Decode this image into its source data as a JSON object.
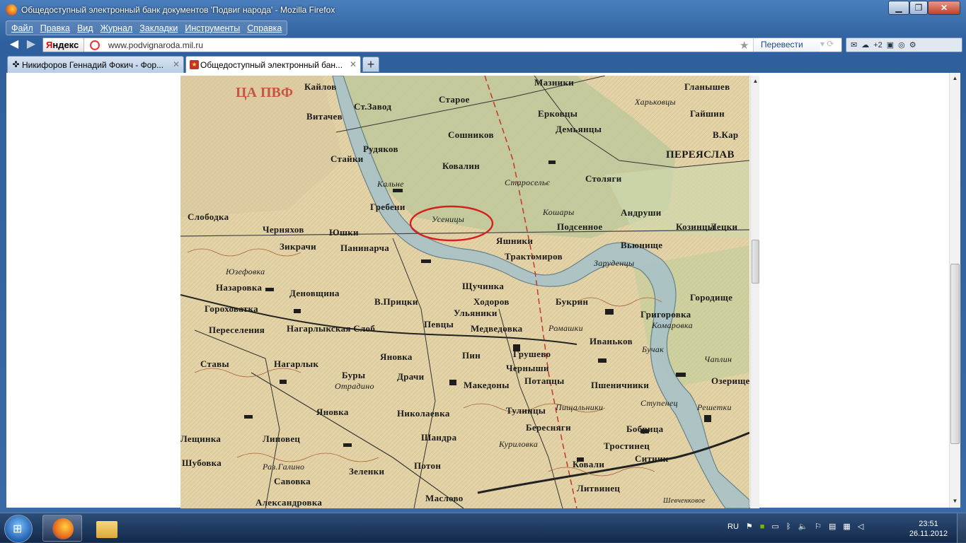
{
  "window": {
    "title": "Общедоступный электронный банк документов 'Подвиг народа' - Mozilla Firefox",
    "minimize_icon": "minimize-icon",
    "maximize_icon": "maximize-icon",
    "close_icon": "close-icon"
  },
  "menu": [
    "Файл",
    "Правка",
    "Вид",
    "Журнал",
    "Закладки",
    "Инструменты",
    "Справка"
  ],
  "navbar": {
    "search_engine": {
      "first": "Я",
      "rest": "ндекс"
    },
    "url": "www.podvignaroda.mil.ru",
    "translate_label": "Перевести",
    "addons_count": "+2"
  },
  "tabs": [
    {
      "label": "Никифоров Геннадий Фокич - Фор...",
      "active": false,
      "icon": "cross-icon"
    },
    {
      "label": "Общедоступный электронный бан...",
      "active": true,
      "icon": "star-medal-icon"
    }
  ],
  "new_tab_label": "+",
  "map": {
    "labels": [
      {
        "text": "Кайлов"
      },
      {
        "text": "Ст.Завод"
      },
      {
        "text": "Старое"
      },
      {
        "text": "Мазники"
      },
      {
        "text": "Гланышев"
      },
      {
        "text": "Харьковцы"
      },
      {
        "text": "Гайшин"
      },
      {
        "text": "Витачев"
      },
      {
        "text": "Ерковцы"
      },
      {
        "text": "Демьянцы"
      },
      {
        "text": "Сошников"
      },
      {
        "text": "В.Кар"
      },
      {
        "text": "Рудяков"
      },
      {
        "text": "Ковалин"
      },
      {
        "text": "ПЕРЕЯСЛАВ"
      },
      {
        "text": "Стайки"
      },
      {
        "text": "Столяги"
      },
      {
        "text": "Старосельє"
      },
      {
        "text": "Гребени"
      },
      {
        "text": "Андруши"
      },
      {
        "text": "Кошары"
      },
      {
        "text": "Козинцы"
      },
      {
        "text": "Лецки"
      },
      {
        "text": "Подсенное"
      },
      {
        "text": "Слободка"
      },
      {
        "text": "Черняхов"
      },
      {
        "text": "Юшки"
      },
      {
        "text": "Усеницы"
      },
      {
        "text": "Яшники"
      },
      {
        "text": "Трактомиров"
      },
      {
        "text": "Зикрачи"
      },
      {
        "text": "Панинарча"
      },
      {
        "text": "Вьюнище"
      },
      {
        "text": "Юзефовка"
      },
      {
        "text": "Назаровка"
      },
      {
        "text": "Деновщина"
      },
      {
        "text": "Щучинка"
      },
      {
        "text": "Заруденцы"
      },
      {
        "text": "Городище"
      },
      {
        "text": "В.Прицки"
      },
      {
        "text": "Ходоров"
      },
      {
        "text": "Букрин"
      },
      {
        "text": "Гороховатка"
      },
      {
        "text": "Ульяники"
      },
      {
        "text": "Григоровка"
      },
      {
        "text": "Переселения"
      },
      {
        "text": "Нагарлыкская Слоб"
      },
      {
        "text": "Певцы"
      },
      {
        "text": "Медведовка"
      },
      {
        "text": "Комаровка"
      },
      {
        "text": "Ромашки"
      },
      {
        "text": "Иваньков"
      },
      {
        "text": "Пин"
      },
      {
        "text": "Грушево"
      },
      {
        "text": "Ставы"
      },
      {
        "text": "Нагарлык"
      },
      {
        "text": "Яновка"
      },
      {
        "text": "Черныши"
      },
      {
        "text": "Бучак"
      },
      {
        "text": "Чаплин"
      },
      {
        "text": "Буры"
      },
      {
        "text": "Драчи"
      },
      {
        "text": "Потапцы"
      },
      {
        "text": "Озерище"
      },
      {
        "text": "Македоны"
      },
      {
        "text": "Пшеничники"
      },
      {
        "text": "Яновка"
      },
      {
        "text": "Николаевка"
      },
      {
        "text": "Тулинцы"
      },
      {
        "text": "Пищальники"
      },
      {
        "text": "Ступенец"
      },
      {
        "text": "Решетки"
      },
      {
        "text": "Лещинка"
      },
      {
        "text": "Липовец"
      },
      {
        "text": "Шандра"
      },
      {
        "text": "Бересняги"
      },
      {
        "text": "Бобрица"
      },
      {
        "text": "Шубовка"
      },
      {
        "text": "Раз.Галино"
      },
      {
        "text": "Потон"
      },
      {
        "text": "Куриловка"
      },
      {
        "text": "Тростинец"
      },
      {
        "text": "Зеленки"
      },
      {
        "text": "Савовка"
      },
      {
        "text": "Ковали"
      },
      {
        "text": "Ситник"
      },
      {
        "text": "Литвинец"
      },
      {
        "text": "Александровка"
      },
      {
        "text": "Маслово"
      },
      {
        "text": "Кальне"
      },
      {
        "text": "Шевченковое"
      },
      {
        "text": "Отрадино"
      }
    ]
  },
  "taskbar": {
    "language": "RU",
    "time": "23:51",
    "date": "26.11.2012"
  }
}
